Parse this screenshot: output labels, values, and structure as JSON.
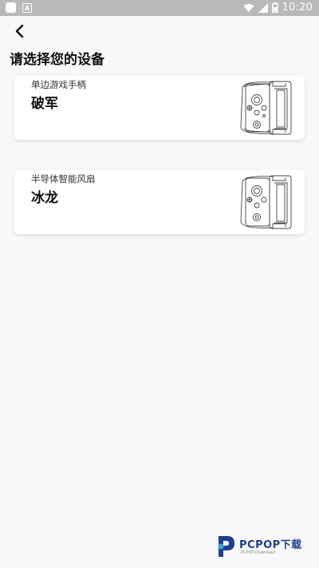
{
  "status_bar": {
    "time": "10:20",
    "left_icons": [
      "notification-square-icon",
      "app-a-icon"
    ],
    "right_icons": [
      "wifi-icon",
      "signal-icon",
      "battery-icon"
    ]
  },
  "header": {
    "back_icon": "chevron-left-icon",
    "title": "请选择您的设备"
  },
  "devices": [
    {
      "category": "单边游戏手柄",
      "name": "破军",
      "image": "single-side-gamepad"
    },
    {
      "category": "半导体智能风扇",
      "name": "冰龙",
      "image": "semiconductor-cooling-fan"
    }
  ],
  "watermark": {
    "main": "PCPOP下载",
    "sub": "PCPOP Download"
  },
  "colors": {
    "status_bar": "#b9b9b9",
    "background": "#f8f8f8",
    "card": "#ffffff",
    "watermark": "#1f3e94"
  }
}
